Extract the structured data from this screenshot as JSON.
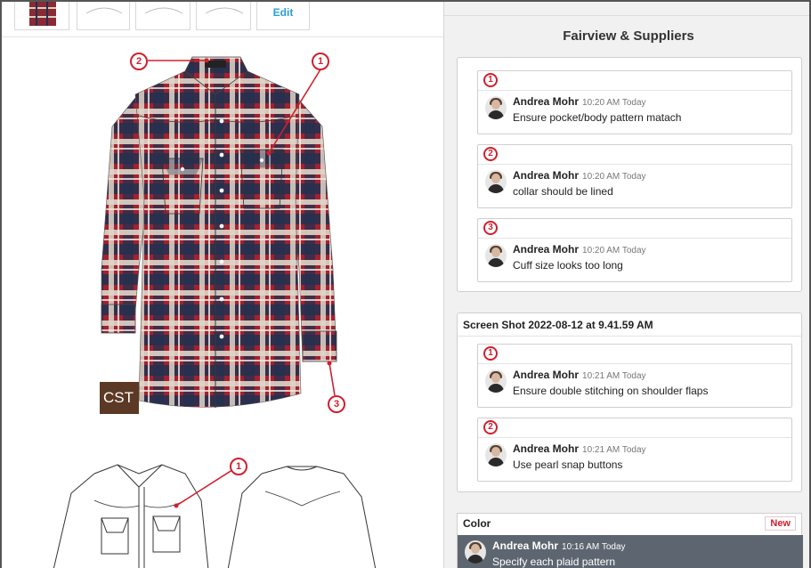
{
  "left": {
    "thumbnail_edit_label": "Edit",
    "swatch_label": "CST",
    "photo_pins": [
      "2",
      "1",
      "3"
    ],
    "flat_pins": [
      "1"
    ]
  },
  "right": {
    "panel_title": "Fairview & Suppliers",
    "group1": {
      "comments": [
        {
          "pin": "1",
          "author": "Andrea Mohr",
          "time": "10:20 AM Today",
          "text": "Ensure pocket/body pattern matach"
        },
        {
          "pin": "2",
          "author": "Andrea Mohr",
          "time": "10:20 AM Today",
          "text": "collar should be lined"
        },
        {
          "pin": "3",
          "author": "Andrea Mohr",
          "time": "10:20 AM Today",
          "text": "Cuff size looks too long"
        }
      ]
    },
    "group2": {
      "title": "Screen Shot 2022-08-12 at 9.41.59 AM",
      "comments": [
        {
          "pin": "1",
          "author": "Andrea Mohr",
          "time": "10:21 AM Today",
          "text": "Ensure double stitching on shoulder flaps"
        },
        {
          "pin": "2",
          "author": "Andrea Mohr",
          "time": "10:21 AM Today",
          "text": "Use pearl snap buttons"
        }
      ]
    },
    "color_thread": {
      "title": "Color",
      "badge": "New",
      "author": "Andrea Mohr",
      "time": "10:16 AM Today",
      "text": "Specify each plaid pattern"
    }
  },
  "colors": {
    "accent_red": "#d0202e",
    "link_blue": "#2a9fd6",
    "selected_comment_bg": "#5d6670",
    "plaid_red": "#a3212f",
    "plaid_navy": "#22304f"
  }
}
